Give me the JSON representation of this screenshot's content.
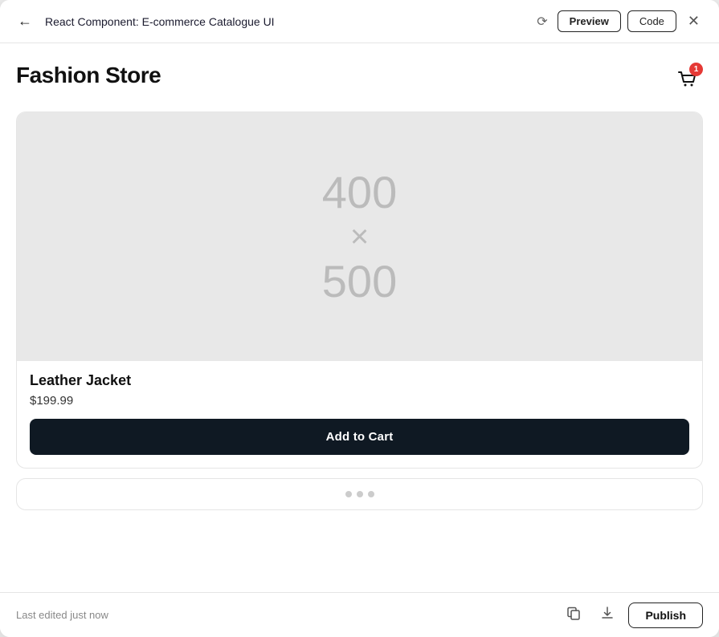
{
  "window": {
    "title": "React Component: E-commerce Catalogue UI"
  },
  "topbar": {
    "back_label": "←",
    "title": "React Component: E-commerce Catalogue UI",
    "refresh_label": "⟳",
    "tab_preview": "Preview",
    "tab_code": "Code",
    "close_label": "✕"
  },
  "store": {
    "title": "Fashion Store"
  },
  "cart": {
    "badge_count": "1"
  },
  "product": {
    "image_width": "400",
    "image_x": "×",
    "image_height": "500",
    "name": "Leather Jacket",
    "price": "$199.99",
    "add_to_cart_label": "Add to Cart"
  },
  "bottombar": {
    "last_edited": "Last edited just now",
    "publish_label": "Publish"
  }
}
